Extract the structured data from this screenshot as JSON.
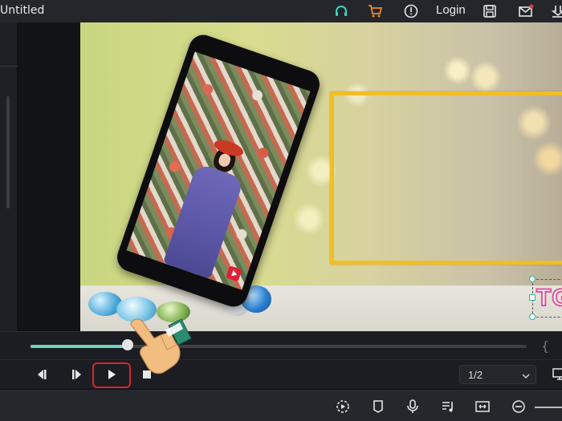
{
  "window": {
    "title": "Untitled"
  },
  "header": {
    "login_label": "Login",
    "icons": [
      "headset-icon",
      "cart-icon",
      "info-icon",
      "save-icon",
      "mail-icon",
      "download-icon"
    ]
  },
  "player": {
    "progress_percent": 19.5,
    "page_indicator": "1/2"
  },
  "preview": {
    "text_overlay": "TG"
  },
  "colors": {
    "accent": "#6fd6c3",
    "headset": "#3fd3c0",
    "cart": "#f08a2a",
    "frame": "#f2bd26",
    "play_highlight": "#d8262c",
    "text_stroke": "#e0529c"
  }
}
